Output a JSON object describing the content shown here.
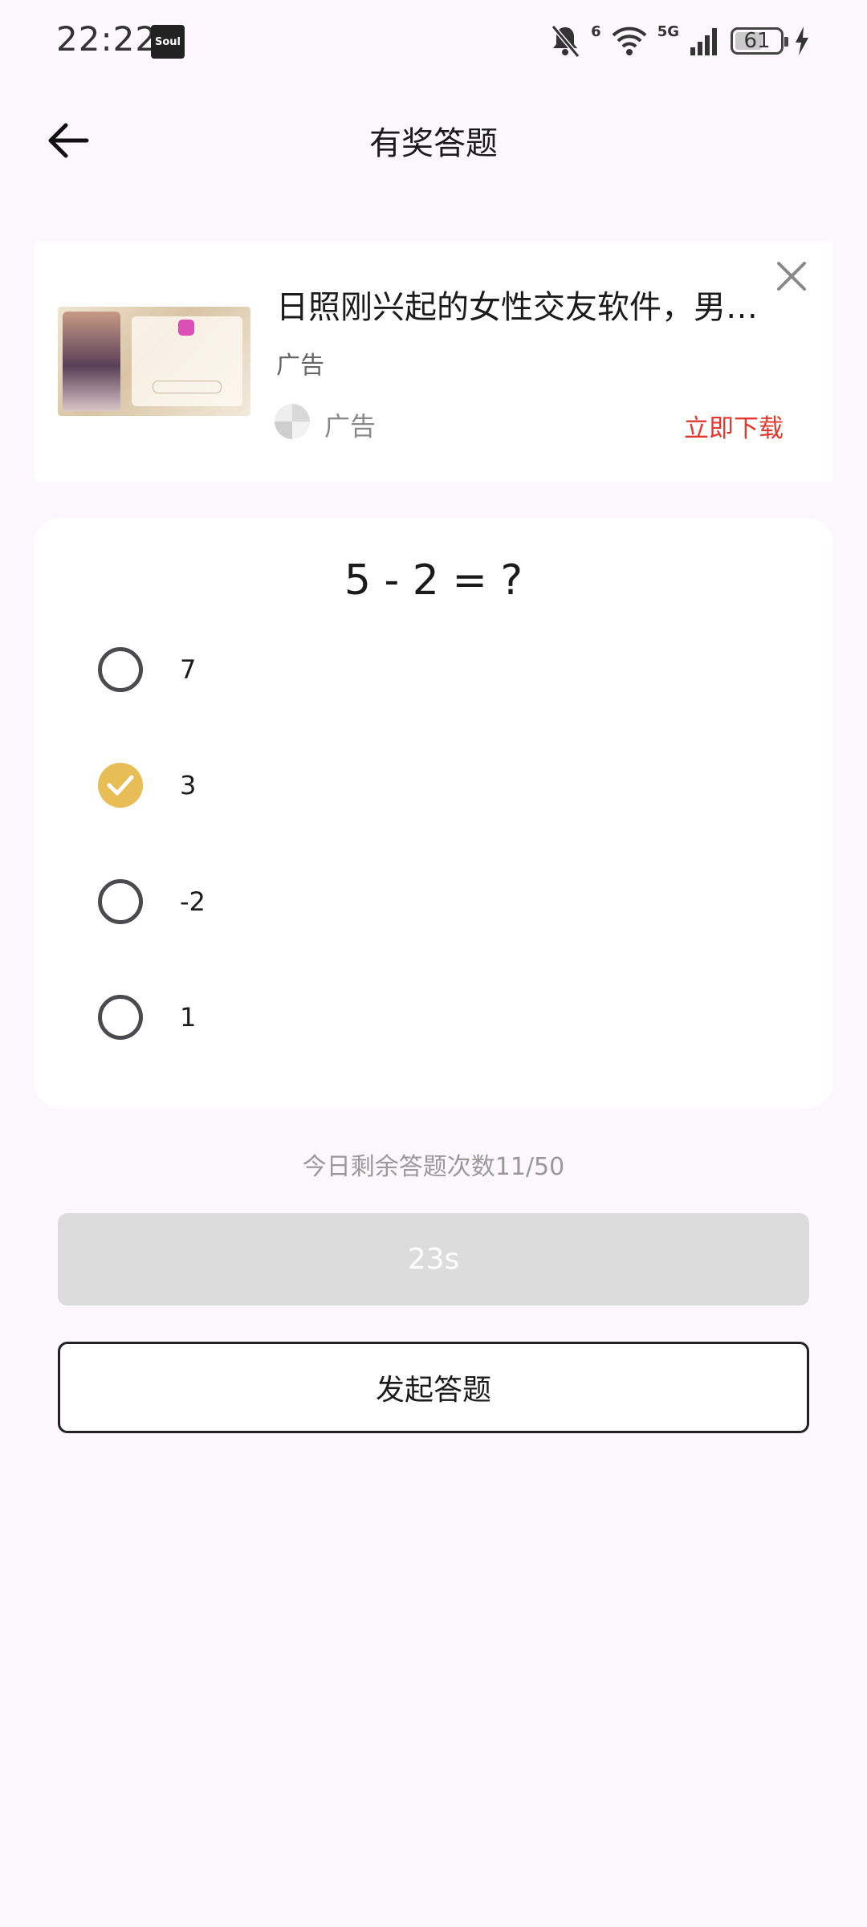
{
  "status_bar": {
    "time": "22:22",
    "app_badge": "Soul",
    "network": "5G",
    "wifi_badge": "6",
    "battery": "61",
    "battery_level_percent": 61
  },
  "header": {
    "title": "有奖答题"
  },
  "ad": {
    "title": "日照刚兴起的女性交友软件，男…",
    "subtitle": "广告",
    "brand": "广告",
    "cta": "立即下载"
  },
  "quiz": {
    "question": "5 - 2 = ?",
    "options": [
      {
        "label": "7",
        "selected": false
      },
      {
        "label": "3",
        "selected": true
      },
      {
        "label": "-2",
        "selected": false
      },
      {
        "label": "1",
        "selected": false
      }
    ]
  },
  "footer": {
    "remaining_text": "今日剩余答题次数11/50",
    "timer_label": "23s",
    "start_label": "发起答题"
  },
  "colors": {
    "selected": "#e8bd55",
    "cta": "#e03a2f",
    "background": "#fbf7fc"
  }
}
